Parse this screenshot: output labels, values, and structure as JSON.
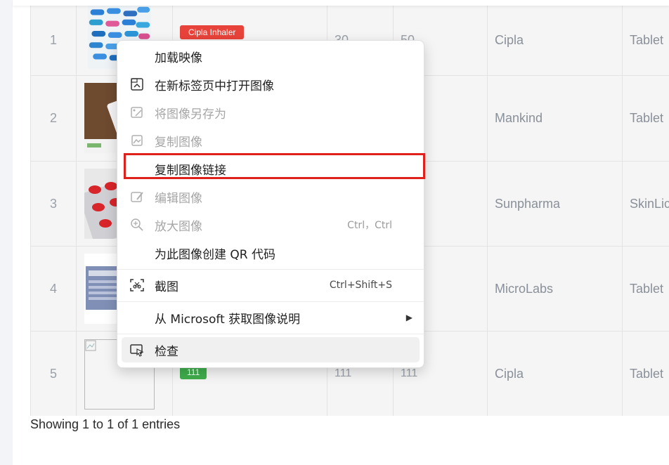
{
  "table": {
    "rows": [
      {
        "index": "1",
        "badge": "Cipla Inhaler",
        "badge_color": "#e8433a",
        "col3": "30",
        "col4": "50",
        "company": "Cipla",
        "category": "Tablet"
      },
      {
        "index": "2",
        "badge": "",
        "badge_color": "",
        "col3": "",
        "col4": "",
        "company": "Mankind",
        "category": "Tablet"
      },
      {
        "index": "3",
        "badge": "",
        "badge_color": "",
        "col3": "",
        "col4": "",
        "company": "Sunpharma",
        "category": "SkinLic"
      },
      {
        "index": "4",
        "badge": "",
        "badge_color": "",
        "col3": "",
        "col4": "",
        "company": "MicroLabs",
        "category": "Tablet"
      },
      {
        "index": "5",
        "badge": "111",
        "badge_color": "#3fae4d",
        "col3": "111",
        "col4": "111",
        "company": "Cipla",
        "category": "Tablet"
      }
    ],
    "footer_text": "Showing 1 to 1 of 1 entries"
  },
  "context_menu": {
    "items": [
      {
        "label": "加载映像",
        "icon": "none",
        "shortcut": "",
        "disabled": false
      },
      {
        "label": "在新标签页中打开图像",
        "icon": "open-in-new-tab-icon",
        "shortcut": "",
        "disabled": false
      },
      {
        "label": "将图像另存为",
        "icon": "save-image-icon",
        "shortcut": "",
        "disabled": true
      },
      {
        "label": "复制图像",
        "icon": "copy-image-icon",
        "shortcut": "",
        "disabled": true
      },
      {
        "label": "复制图像链接",
        "icon": "none",
        "shortcut": "",
        "disabled": false
      },
      {
        "label": "编辑图像",
        "icon": "edit-image-icon",
        "shortcut": "",
        "disabled": true
      },
      {
        "label": "放大图像",
        "icon": "zoom-image-icon",
        "shortcut": "Ctrl，Ctrl",
        "disabled": true
      },
      {
        "label": "为此图像创建 QR 代码",
        "icon": "none",
        "shortcut": "",
        "disabled": false
      },
      {
        "label": "截图",
        "icon": "screenshot-icon",
        "shortcut": "Ctrl+Shift+S",
        "disabled": false
      },
      {
        "label": "从 Microsoft 获取图像说明",
        "icon": "none",
        "shortcut": "",
        "disabled": false
      },
      {
        "label": "检查",
        "icon": "inspect-icon",
        "shortcut": "",
        "disabled": false
      }
    ],
    "highlight_color": "#e0211b"
  }
}
